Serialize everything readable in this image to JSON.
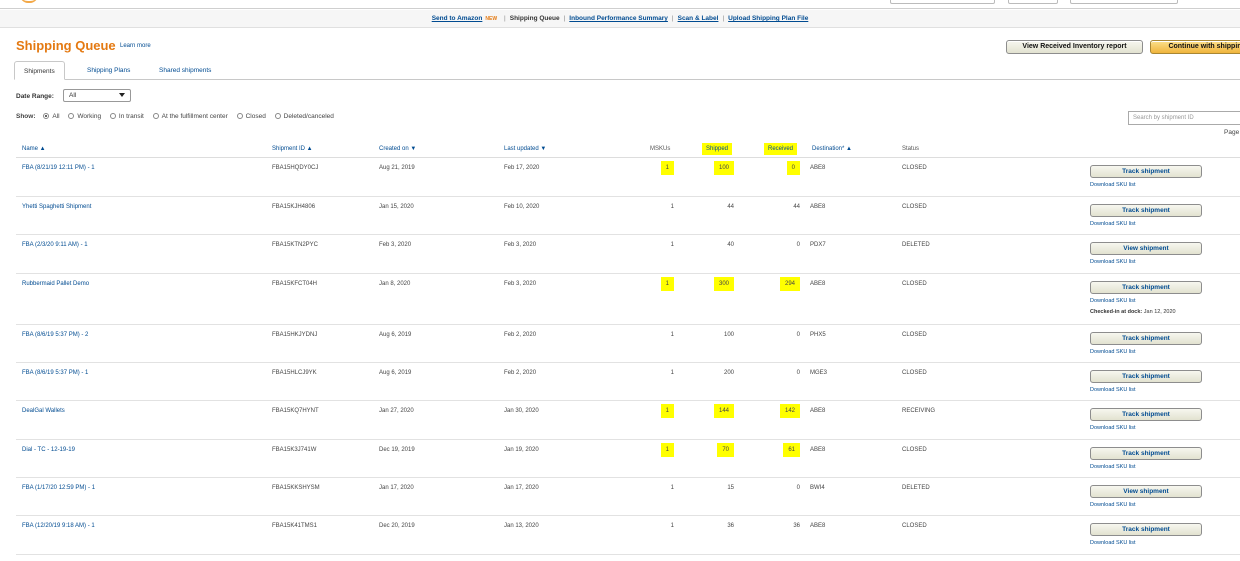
{
  "subnav": {
    "send_to_amazon": "Send to Amazon",
    "new_badge": "NEW",
    "shipping_queue": "Shipping Queue",
    "inbound_summary": "Inbound Performance Summary",
    "scan_label": "Scan & Label",
    "upload_plan": "Upload Shipping Plan File",
    "separator": "|"
  },
  "page": {
    "title": "Shipping Queue",
    "learn_more": "Learn more",
    "view_received_button": "View Received Inventory report",
    "continue_button": "Continue with shippin"
  },
  "tabs": [
    "Shipments",
    "Shipping Plans",
    "Shared shipments"
  ],
  "filters": {
    "date_range_label": "Date Range:",
    "date_range_value": "All",
    "show_label": "Show:",
    "options": [
      "All",
      "Working",
      "In transit",
      "At the fulfillment center",
      "Closed",
      "Deleted/canceled"
    ],
    "selected": "All"
  },
  "search": {
    "placeholder": "Search by shipment ID"
  },
  "pagination": {
    "label": "Page"
  },
  "table": {
    "headers": {
      "name": "Name ▲",
      "shipment_id": "Shipment ID ▲",
      "created": "Created on ▼",
      "updated": "Last updated ▼",
      "mskus": "MSKUs",
      "shipped": "Shipped",
      "received": "Received",
      "destination": "Destination* ▲",
      "status": "Status"
    },
    "download_label": "Download SKU list",
    "rows": [
      {
        "name": "FBA (8/21/19 12:11 PM) - 1",
        "id": "FBA15HQDY0CJ",
        "created": "Aug 21, 2019",
        "updated": "Feb 17, 2020",
        "mskus": "1",
        "shipped": "100",
        "received": "0",
        "dest": "ABE8",
        "status": "CLOSED",
        "action": "Track shipment",
        "hl": true
      },
      {
        "name": "Yhetti Spaghetti Shipment",
        "id": "FBA15KJH4806",
        "created": "Jan 15, 2020",
        "updated": "Feb 10, 2020",
        "mskus": "1",
        "shipped": "44",
        "received": "44",
        "dest": "ABE8",
        "status": "CLOSED",
        "action": "Track shipment",
        "hl": false
      },
      {
        "name": "FBA (2/3/20 9:11 AM) - 1",
        "id": "FBA15KTN2PYC",
        "created": "Feb 3, 2020",
        "updated": "Feb 3, 2020",
        "mskus": "1",
        "shipped": "40",
        "received": "0",
        "dest": "PDX7",
        "status": "DELETED",
        "action": "View shipment",
        "hl": false
      },
      {
        "name": "Rubbermaid Pallet Demo",
        "id": "FBA15KFCT04H",
        "created": "Jan 8, 2020",
        "updated": "Feb 3, 2020",
        "mskus": "1",
        "shipped": "300",
        "received": "294",
        "dest": "ABE8",
        "status": "CLOSED",
        "action": "Track shipment",
        "hl": true,
        "note_label": "Checked-in at dock:",
        "note_value": "Jan 12, 2020"
      },
      {
        "name": "FBA (8/6/19 5:37 PM) - 2",
        "id": "FBA15HKJYDNJ",
        "created": "Aug 6, 2019",
        "updated": "Feb 2, 2020",
        "mskus": "1",
        "shipped": "100",
        "received": "0",
        "dest": "PHX5",
        "status": "CLOSED",
        "action": "Track shipment",
        "hl": false
      },
      {
        "name": "FBA (8/6/19 5:37 PM) - 1",
        "id": "FBA15HLCJ9YK",
        "created": "Aug 6, 2019",
        "updated": "Feb 2, 2020",
        "mskus": "1",
        "shipped": "200",
        "received": "0",
        "dest": "MGE3",
        "status": "CLOSED",
        "action": "Track shipment",
        "hl": false
      },
      {
        "name": "DealGal Wallets",
        "id": "FBA15KQ7HYNT",
        "created": "Jan 27, 2020",
        "updated": "Jan 30, 2020",
        "mskus": "1",
        "shipped": "144",
        "received": "142",
        "dest": "ABE8",
        "status": "RECEIVING",
        "action": "Track shipment",
        "hl": true
      },
      {
        "name": "Dial - TC - 12-19-19",
        "id": "FBA15K3J741W",
        "created": "Dec 19, 2019",
        "updated": "Jan 19, 2020",
        "mskus": "1",
        "shipped": "70",
        "received": "61",
        "dest": "ABE8",
        "status": "CLOSED",
        "action": "Track shipment",
        "hl": true
      },
      {
        "name": "FBA (1/17/20 12:59 PM) - 1",
        "id": "FBA15KKSHYSM",
        "created": "Jan 17, 2020",
        "updated": "Jan 17, 2020",
        "mskus": "1",
        "shipped": "15",
        "received": "0",
        "dest": "BWI4",
        "status": "DELETED",
        "action": "View shipment",
        "hl": false
      },
      {
        "name": "FBA (12/20/19 9:18 AM) - 1",
        "id": "FBA15K41TMS1",
        "created": "Dec 20, 2019",
        "updated": "Jan 13, 2020",
        "mskus": "1",
        "shipped": "36",
        "received": "36",
        "dest": "ABE8",
        "status": "CLOSED",
        "action": "Track shipment",
        "hl": false
      }
    ]
  }
}
